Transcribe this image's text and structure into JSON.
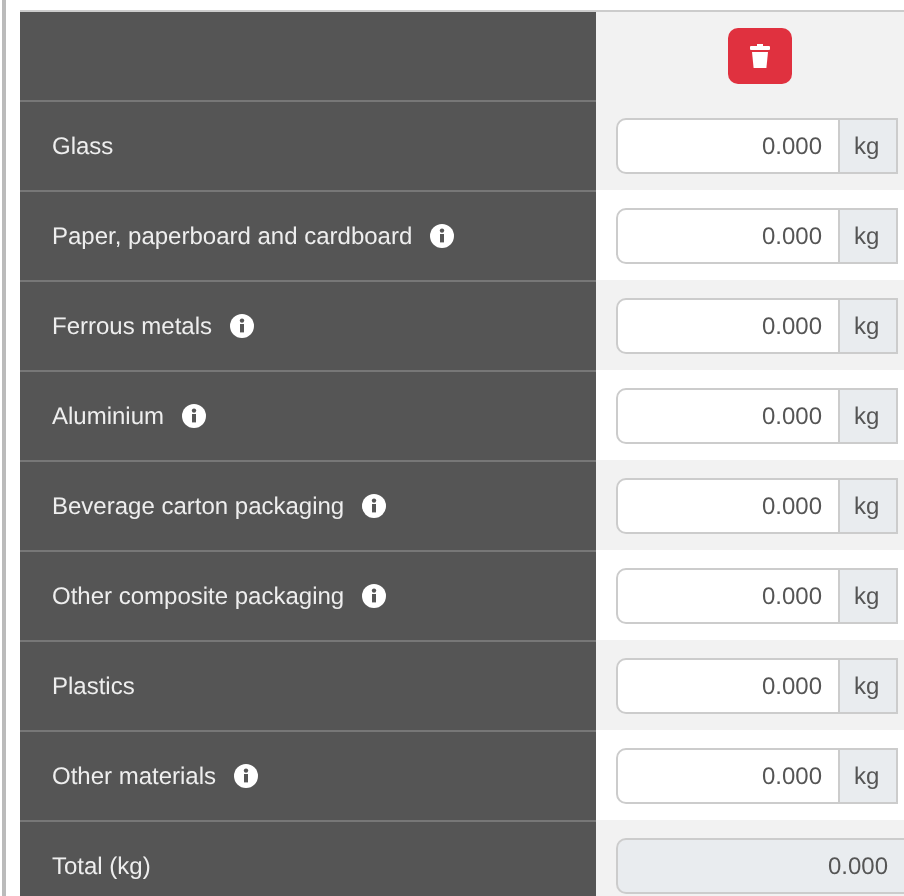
{
  "rows": [
    {
      "label": "Glass",
      "info": false,
      "value": "0.000",
      "unit": "kg"
    },
    {
      "label": "Paper, paperboard and cardboard",
      "info": true,
      "value": "0.000",
      "unit": "kg"
    },
    {
      "label": "Ferrous metals",
      "info": true,
      "value": "0.000",
      "unit": "kg"
    },
    {
      "label": "Aluminium",
      "info": true,
      "value": "0.000",
      "unit": "kg"
    },
    {
      "label": "Beverage carton packaging",
      "info": true,
      "value": "0.000",
      "unit": "kg"
    },
    {
      "label": "Other composite packaging",
      "info": true,
      "value": "0.000",
      "unit": "kg"
    },
    {
      "label": "Plastics",
      "info": false,
      "value": "0.000",
      "unit": "kg"
    },
    {
      "label": "Other materials",
      "info": true,
      "value": "0.000",
      "unit": "kg"
    }
  ],
  "total": {
    "label": "Total (kg)",
    "value": "0.000"
  }
}
